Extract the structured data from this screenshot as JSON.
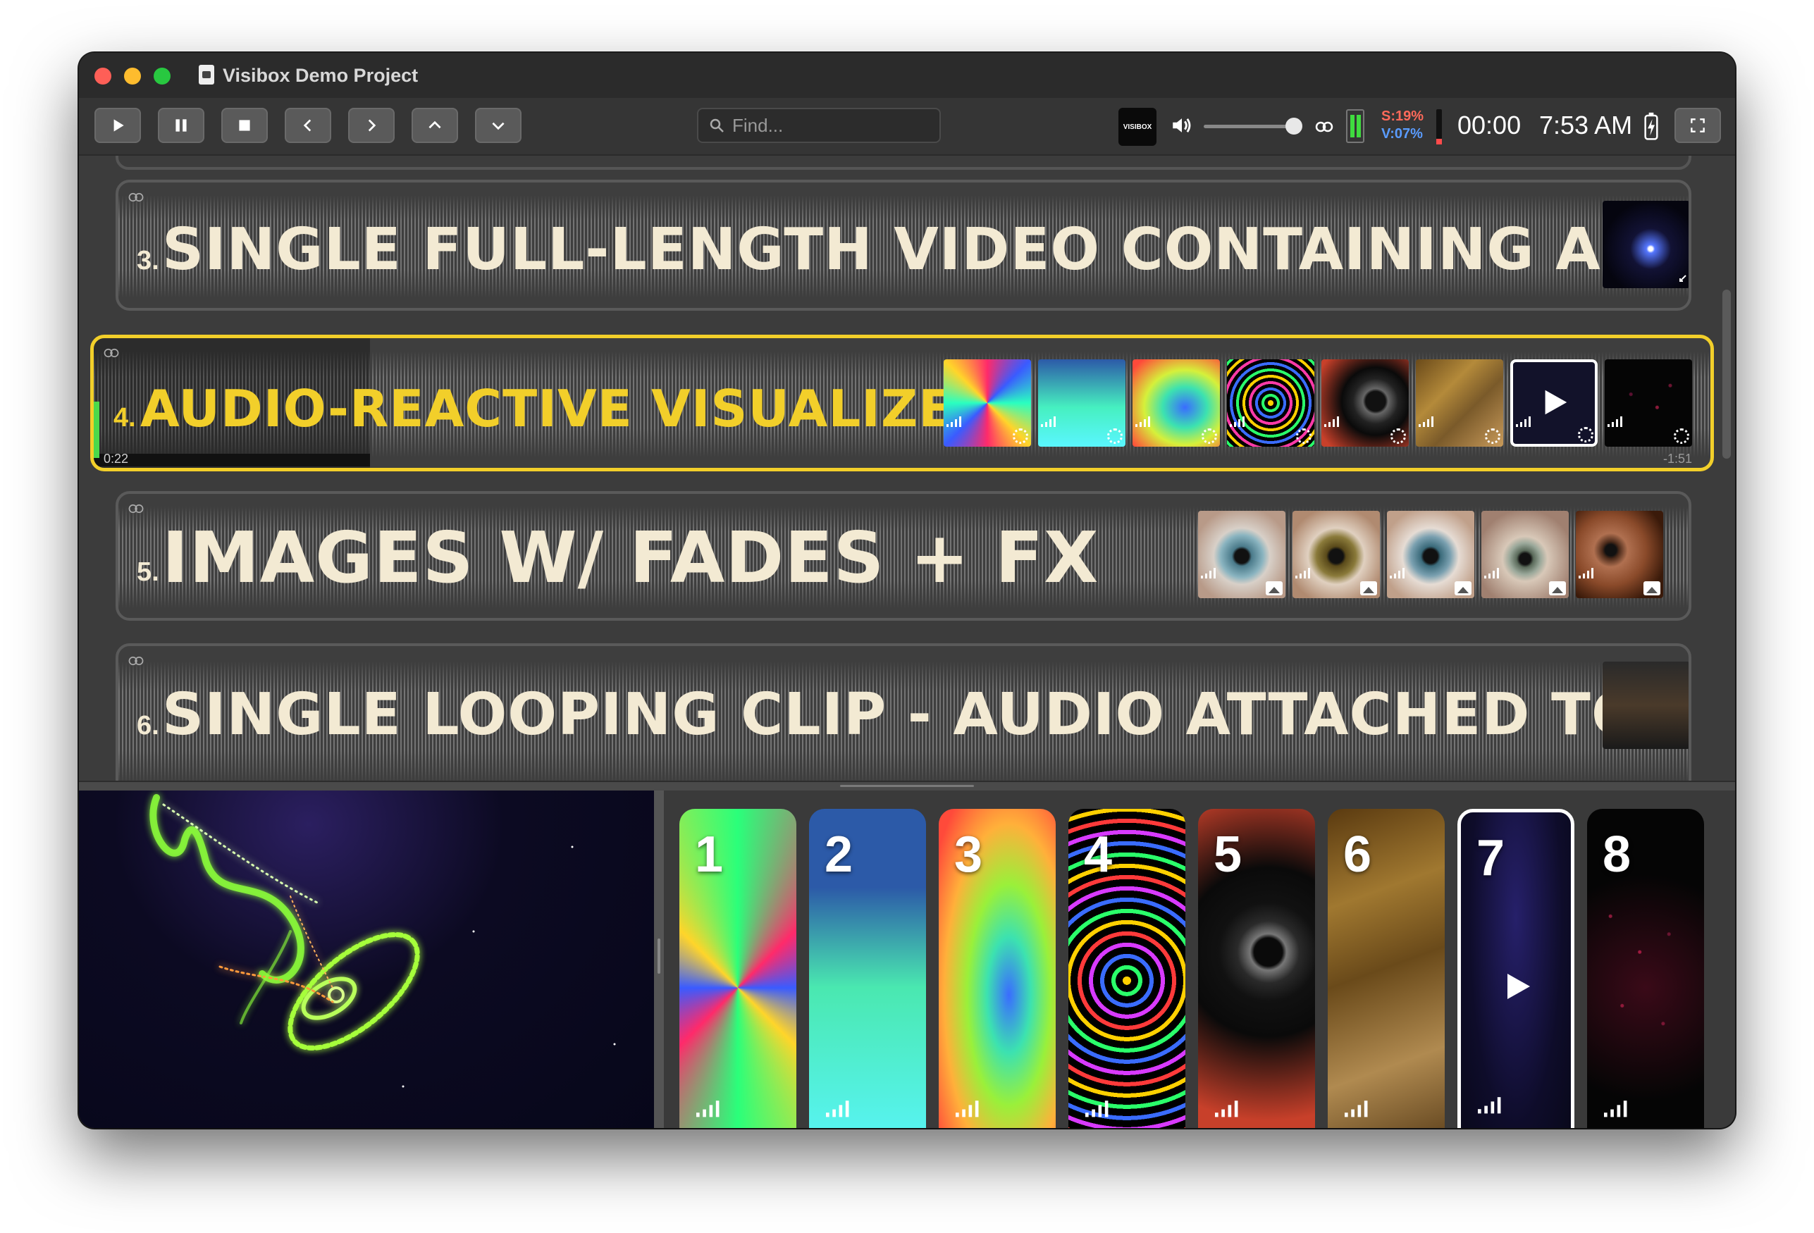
{
  "window": {
    "title": "Visibox Demo Project"
  },
  "toolbar": {
    "search_placeholder": "Find...",
    "logo_text": "VISIBOX",
    "cpu_s": "S:19%",
    "cpu_v": "V:07%",
    "timecode": "00:00",
    "clock": "7:53 AM",
    "colors": {
      "s": "#ff6a5a",
      "v": "#5a9cff",
      "meter": "#3fdc3f"
    }
  },
  "cues": [
    {
      "num": "3.",
      "title": "SINGLE FULL-LENGTH VIDEO CONTAINING AUDIO"
    },
    {
      "num": "4.",
      "title": "AUDIO-REACTIVE VISUALIZERS",
      "elapsed": "0:22",
      "remaining": "-1:51",
      "progress": 0.17
    },
    {
      "num": "5.",
      "title": "IMAGES W/ FADES + FX"
    },
    {
      "num": "6.",
      "title": "SINGLE LOOPING CLIP - AUDIO ATTACHED TO SONG"
    }
  ],
  "bank": {
    "tiles": [
      {
        "num": "1",
        "icon": "kaleidoscope-visual"
      },
      {
        "num": "2",
        "icon": "gradient-visual"
      },
      {
        "num": "3",
        "icon": "rainbow-blur-visual"
      },
      {
        "num": "4",
        "icon": "concentric-rings-visual"
      },
      {
        "num": "5",
        "icon": "swirl-visual"
      },
      {
        "num": "6",
        "icon": "gold-texture-visual"
      },
      {
        "num": "7",
        "icon": "play-icon"
      },
      {
        "num": "8",
        "icon": "particles-visual"
      }
    ]
  },
  "accent": "#f2cf2a"
}
